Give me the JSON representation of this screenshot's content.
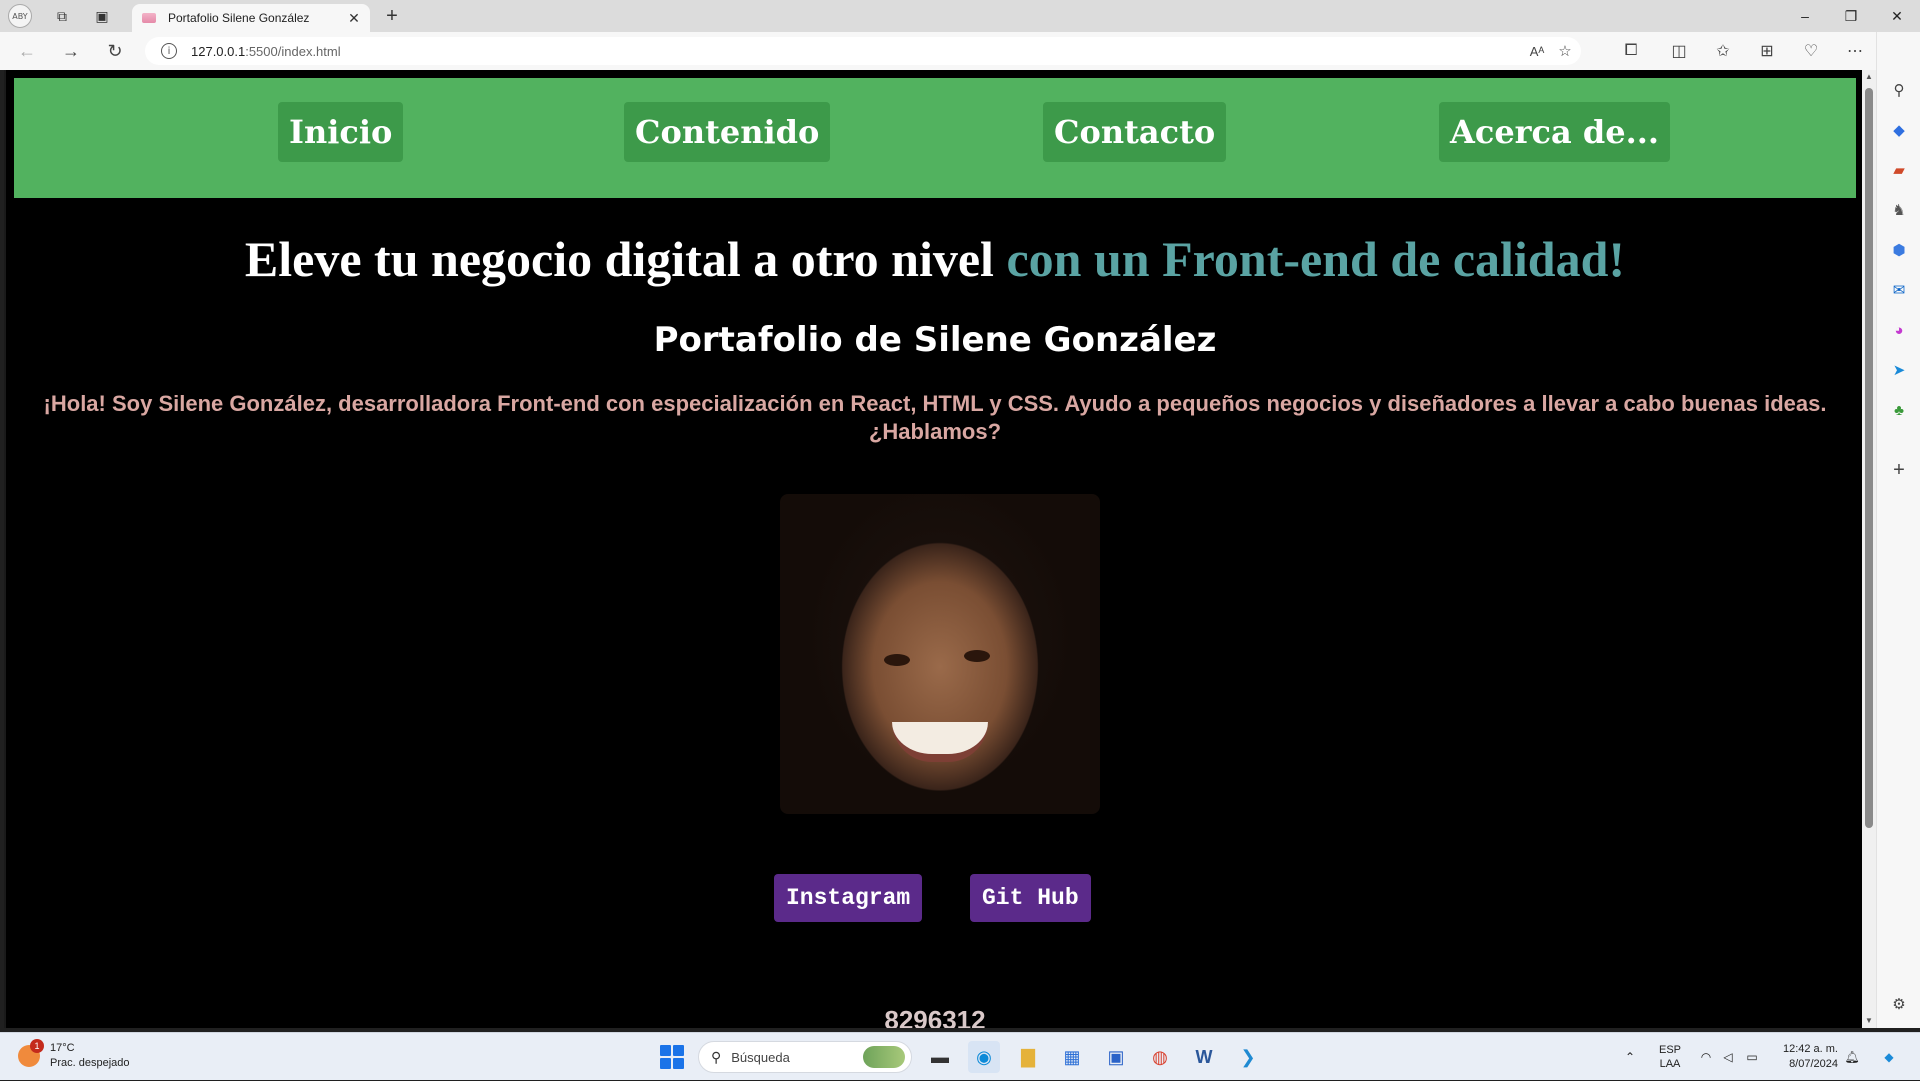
{
  "browser": {
    "profile_label": "ABY",
    "tab_title": "Portafolio Silene González",
    "url_host": "127.0.0.1",
    "url_rest": ":5500/index.html",
    "read_aloud_label": "Aᴬ"
  },
  "page": {
    "nav": [
      "Inicio",
      "Contenido",
      "Contacto",
      "Acerca de..."
    ],
    "headline_main": "Eleve tu negocio digital a otro nivel",
    "headline_accent": "con un Front-end de calidad!",
    "subtitle": "Portafolio de Silene González",
    "intro_line1": "¡Hola! Soy Silene González, desarrolladora Front-end con especialización en React, HTML y CSS. Ayudo a pequeños negocios y diseñadores a llevar a cabo buenas ideas.",
    "intro_line2": "¿Hablamos?",
    "buttons": {
      "instagram": "Instagram",
      "github": "Git Hub"
    },
    "phone": "8296312"
  },
  "taskbar": {
    "weather_temp": "17°C",
    "weather_desc": "Prac. despejado",
    "weather_badge": "1",
    "search_placeholder": "Búsqueda",
    "lang_top": "ESP",
    "lang_bottom": "LAA",
    "time": "12:42 a. m.",
    "date": "8/07/2024"
  },
  "colors": {
    "navbar": "#52b25f",
    "nav_button": "#3d9a4a",
    "accent_heading": "#5aa3a3",
    "intro_text": "#d9a7a2",
    "social_button": "#5b2a8a"
  },
  "icons": [
    "workspaces-icon",
    "tab-actions-icon",
    "back-icon",
    "forward-icon",
    "refresh-icon",
    "info-icon",
    "read-aloud-icon",
    "favorite-star-icon",
    "extensions-icon",
    "split-screen-icon",
    "favorites-icon",
    "collections-icon",
    "browser-essentials-icon",
    "more-icon",
    "copilot-icon"
  ]
}
